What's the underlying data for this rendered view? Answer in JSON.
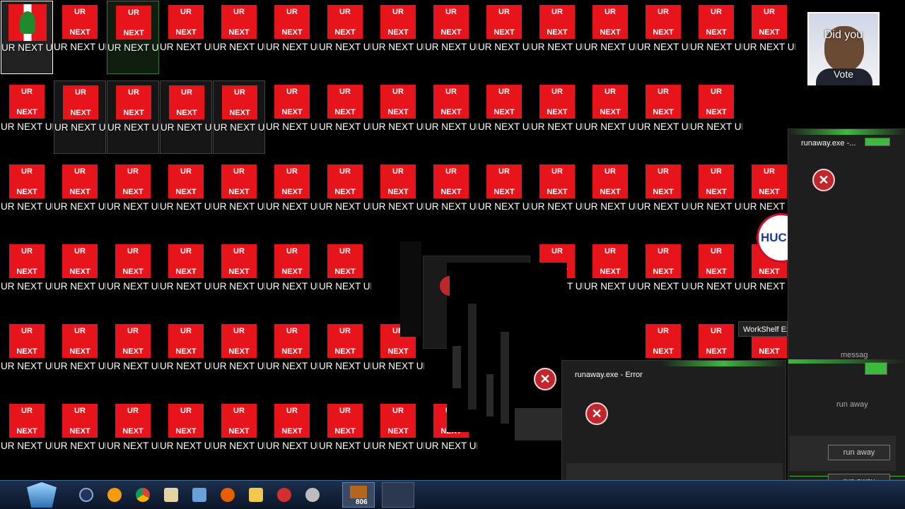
{
  "icon": {
    "title_line1": "UR",
    "title_line2": "NEXT",
    "label": "UR NEXT UR NEXT.exe"
  },
  "first_icon_label": "UR NEXT UR NEXT",
  "popup_ad": {
    "line1": "Did you",
    "line2": "Vote"
  },
  "badge_text": "HUCK",
  "window_right": {
    "title": "runaway.exe -...",
    "message": "messag",
    "text": "run away",
    "button": "run away",
    "button2": "run away"
  },
  "window_error": {
    "title": "runaway.exe - Error"
  },
  "tooltip": "WorkShelf Ex",
  "taskbar": {
    "count": "806"
  },
  "colors": {
    "icon_red": "#e8141b",
    "error_red": "#c0262d"
  }
}
